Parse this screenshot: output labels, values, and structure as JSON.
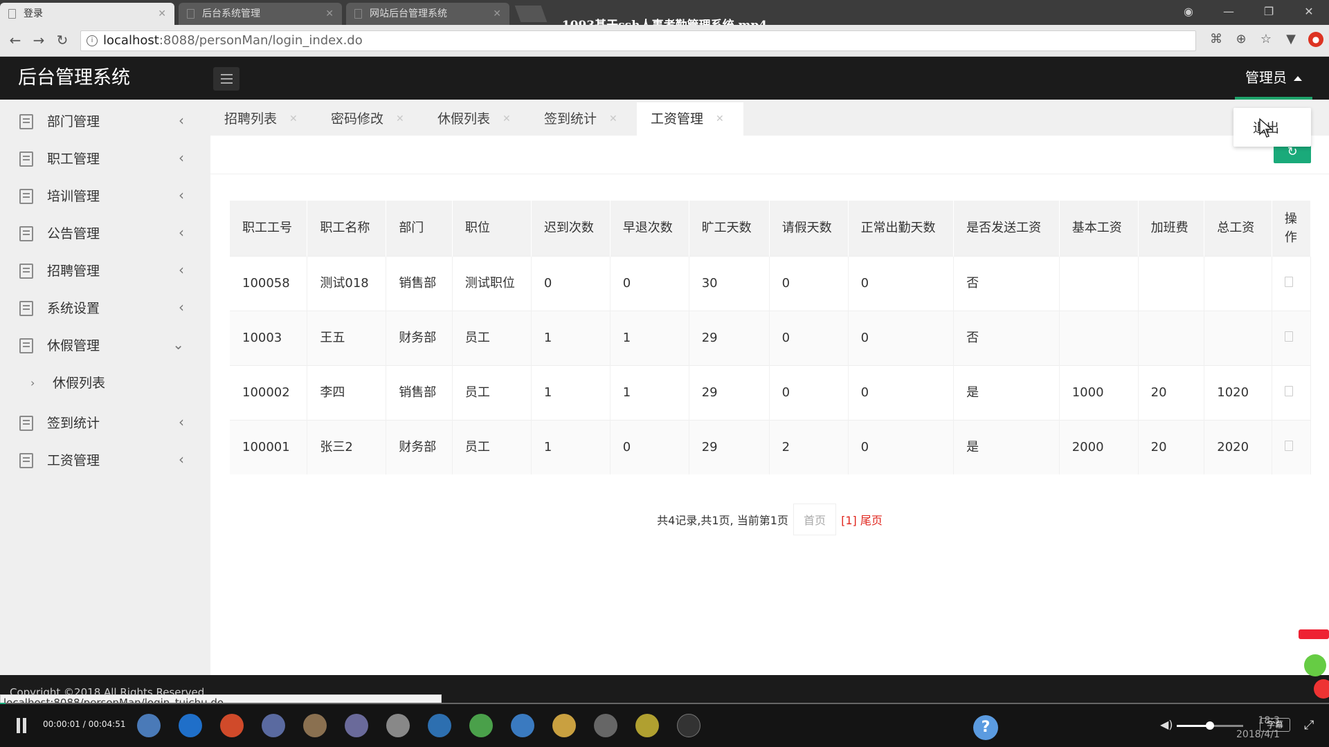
{
  "browser": {
    "tabs": [
      {
        "label": "登录",
        "active": true
      },
      {
        "label": "后台系统管理",
        "active": false
      },
      {
        "label": "网站后台管理系统",
        "active": false
      }
    ],
    "video_title": "1093基于ssh人事考勤管理系统.mp4",
    "url_host": "localhost",
    "url_path": ":8088/personMan/login_index.do"
  },
  "app": {
    "logo": "后台管理系统",
    "user_menu": "管理员",
    "user_dropdown": {
      "logout": "退出"
    },
    "accent_color": "#1ea36b"
  },
  "sidebar": {
    "items": [
      {
        "label": "部门管理"
      },
      {
        "label": "职工管理"
      },
      {
        "label": "培训管理"
      },
      {
        "label": "公告管理"
      },
      {
        "label": "招聘管理"
      },
      {
        "label": "系统设置"
      },
      {
        "label": "休假管理",
        "expanded": true
      },
      {
        "label": "签到统计"
      },
      {
        "label": "工资管理"
      }
    ],
    "sub_items": [
      {
        "label": "休假列表"
      }
    ],
    "chevron_right": "‹",
    "chevron_down": "⌄"
  },
  "page_tabs": [
    {
      "label": "招聘列表"
    },
    {
      "label": "密码修改"
    },
    {
      "label": "休假列表"
    },
    {
      "label": "签到统计"
    },
    {
      "label": "工资管理",
      "active": true
    }
  ],
  "table": {
    "headers": [
      "职工工号",
      "职工名称",
      "部门",
      "职位",
      "迟到次数",
      "早退次数",
      "旷工天数",
      "请假天数",
      "正常出勤天数",
      "是否发送工资",
      "基本工资",
      "加班费",
      "总工资",
      "操作"
    ],
    "rows": [
      [
        "100058",
        "测试018",
        "销售部",
        "测试职位",
        "0",
        "0",
        "30",
        "0",
        "0",
        "否",
        "",
        "",
        ""
      ],
      [
        "10003",
        "王五",
        "财务部",
        "员工",
        "1",
        "1",
        "29",
        "0",
        "0",
        "否",
        "",
        "",
        ""
      ],
      [
        "100002",
        "李四",
        "销售部",
        "员工",
        "1",
        "1",
        "29",
        "0",
        "0",
        "是",
        "1000",
        "20",
        "1020"
      ],
      [
        "100001",
        "张三2",
        "财务部",
        "员工",
        "1",
        "0",
        "29",
        "2",
        "0",
        "是",
        "2000",
        "20",
        "2020"
      ]
    ]
  },
  "pager": {
    "summary": "共4记录,共1页, 当前第1页",
    "first": "首页",
    "current": "[1]",
    "last": "尾页"
  },
  "footer": {
    "copyright": "Copyright ©2018 All Rights Reserved",
    "status_url": "localhost:8088/personMan/login_tuichu.do"
  },
  "player": {
    "time": "00:00:01 / 00:04:51",
    "subtitle_button": "字幕",
    "clock_time": "18:3",
    "clock_date": "2018/4/1"
  }
}
